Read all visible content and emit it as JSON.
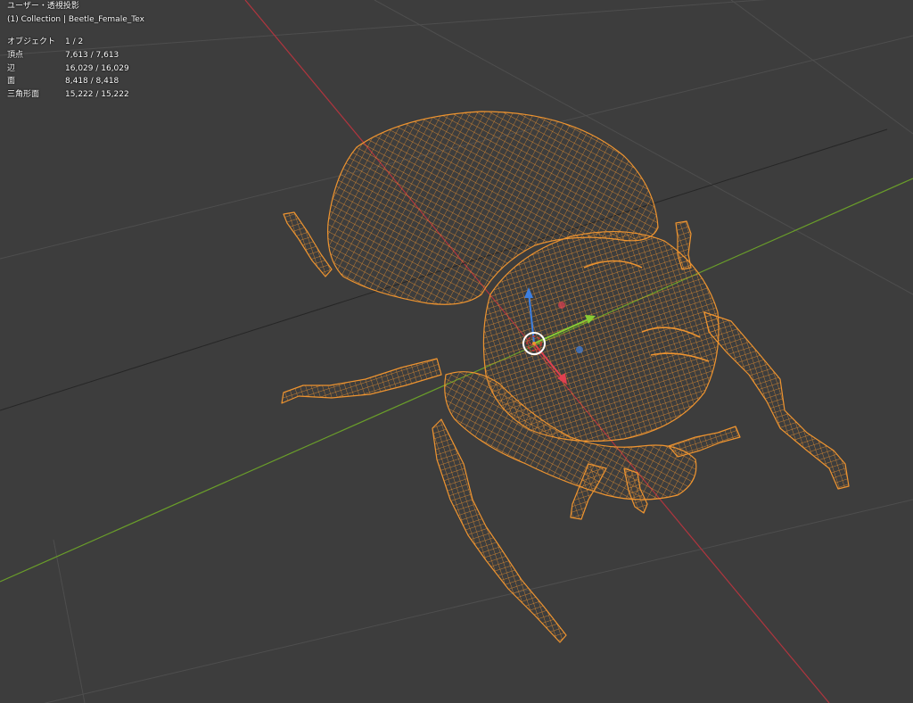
{
  "viewport": {
    "view_name": "ユーザー・透視投影",
    "collection": "(1) Collection | Beetle_Female_Tex",
    "stats": [
      {
        "label": "オブジェクト",
        "value": "1 / 2"
      },
      {
        "label": "頂点",
        "value": "7,613 / 7,613"
      },
      {
        "label": "辺",
        "value": "16,029 / 16,029"
      },
      {
        "label": "面",
        "value": "8,418 / 8,418"
      },
      {
        "label": "三角形面",
        "value": "15,222 / 15,222"
      }
    ]
  },
  "colors": {
    "background": "#3d3d3d",
    "grid": "#4e4e4e",
    "axis_x": "#b0353e",
    "axis_y": "#6a9e2a",
    "wireframe": "#ee9430",
    "gizmo_x": "#e04050",
    "gizmo_y": "#88cc33",
    "gizmo_z": "#3d7fe0"
  },
  "icons": [
    "object-origin-icon",
    "transform-gizmo-icon"
  ]
}
